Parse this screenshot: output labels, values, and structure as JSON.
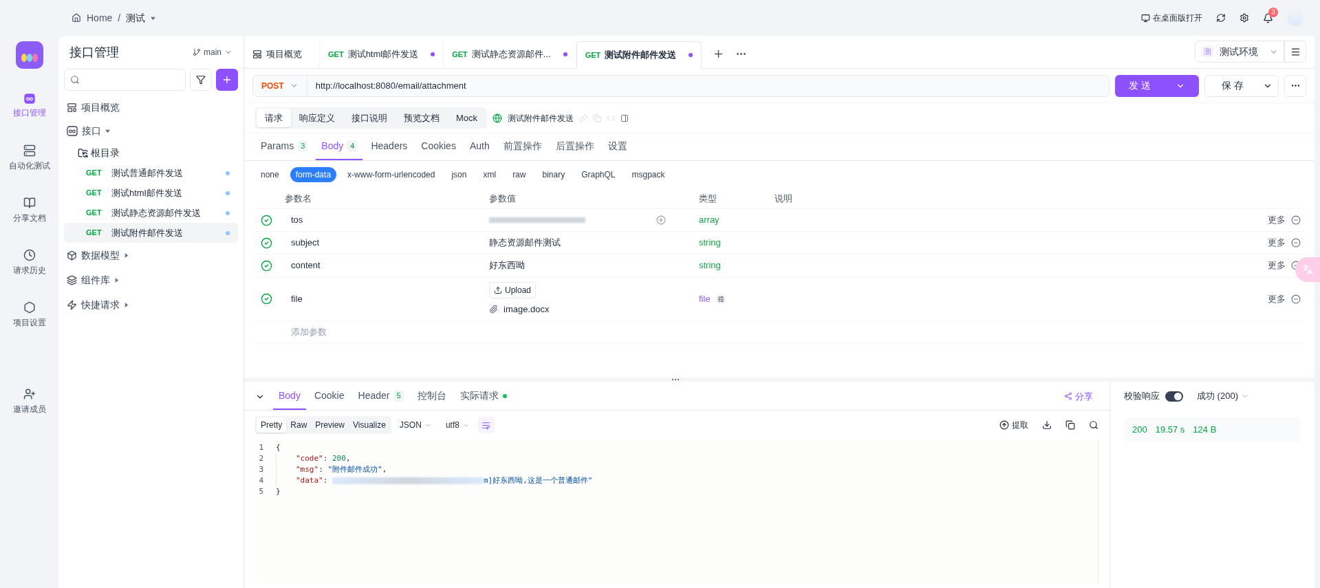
{
  "top_bar": {
    "breadcrumb": [
      "Home",
      "测试"
    ],
    "separator": "/",
    "open_desktop": "在桌面版打开",
    "notification_count": "3"
  },
  "rail": [
    {
      "label": "接口管理",
      "selected": true
    },
    {
      "label": "自动化测试",
      "selected": false
    },
    {
      "label": "分享文档",
      "selected": false
    },
    {
      "label": "请求历史",
      "selected": false
    },
    {
      "label": "项目设置",
      "selected": false
    },
    {
      "label": "邀请成员",
      "selected": false
    }
  ],
  "tree_panel": {
    "title": "接口管理",
    "branch": "main",
    "items": [
      {
        "kind": "overview",
        "label": "项目概览"
      },
      {
        "kind": "group",
        "label": "接口",
        "expanded": true,
        "children": [
          {
            "kind": "folder",
            "label": "根目录",
            "children": [
              {
                "kind": "endpoint",
                "method": "GET",
                "label": "测试普通邮件发送",
                "selected": false
              },
              {
                "kind": "endpoint",
                "method": "GET",
                "label": "测试html邮件发送",
                "selected": false
              },
              {
                "kind": "endpoint",
                "method": "GET",
                "label": "测试静态资源邮件发送",
                "selected": false
              },
              {
                "kind": "endpoint",
                "method": "GET",
                "label": "测试附件邮件发送",
                "selected": true
              }
            ]
          }
        ]
      },
      {
        "kind": "group",
        "label": "数据模型",
        "expanded": false
      },
      {
        "kind": "group",
        "label": "组件库",
        "expanded": false
      },
      {
        "kind": "group",
        "label": "快捷请求",
        "expanded": false
      }
    ]
  },
  "tabs": [
    {
      "kind": "overview",
      "label": "项目概览",
      "selected": false
    },
    {
      "kind": "endpoint",
      "method": "GET",
      "label": "测试html邮件发送",
      "selected": false,
      "unsaved": true
    },
    {
      "kind": "endpoint",
      "method": "GET",
      "label": "测试静态资源邮件...",
      "selected": false,
      "unsaved": true
    },
    {
      "kind": "endpoint",
      "method": "GET",
      "label": "测试附件邮件发送",
      "selected": true,
      "unsaved": true
    }
  ],
  "environment": {
    "badge": "测",
    "label": "测试环境"
  },
  "request": {
    "method": "POST",
    "url": "http://localhost:8080/email/attachment",
    "send": "发送",
    "save": "保存"
  },
  "request_tabs": [
    {
      "label": "请求",
      "selected": true
    },
    {
      "label": "响应定义",
      "selected": false
    },
    {
      "label": "接口说明",
      "selected": false
    },
    {
      "label": "预览文档",
      "selected": false
    },
    {
      "label": "Mock",
      "selected": false
    }
  ],
  "endpoint_name": "测试附件邮件发送",
  "param_tabs": [
    {
      "label": "Params",
      "count": "3",
      "selected": false
    },
    {
      "label": "Body",
      "count": "4",
      "selected": true
    },
    {
      "label": "Headers",
      "selected": false
    },
    {
      "label": "Cookies",
      "selected": false
    },
    {
      "label": "Auth",
      "selected": false
    },
    {
      "label": "前置操作",
      "selected": false
    },
    {
      "label": "后置操作",
      "selected": false
    },
    {
      "label": "设置",
      "selected": false
    }
  ],
  "body_types": [
    {
      "label": "none",
      "selected": false
    },
    {
      "label": "form-data",
      "selected": true
    },
    {
      "label": "x-www-form-urlencoded",
      "selected": false
    },
    {
      "label": "json",
      "selected": false
    },
    {
      "label": "xml",
      "selected": false
    },
    {
      "label": "raw",
      "selected": false
    },
    {
      "label": "binary",
      "selected": false
    },
    {
      "label": "GraphQL",
      "selected": false
    },
    {
      "label": "msgpack",
      "selected": false
    }
  ],
  "table": {
    "columns": [
      "参数名",
      "参数值",
      "类型",
      "说明"
    ],
    "rows": [
      {
        "kind": "redacted",
        "enabled": true,
        "name": "tos",
        "type": "array",
        "color": "#16a34a",
        "more": "更多"
      },
      {
        "kind": "text",
        "enabled": true,
        "name": "subject",
        "value": "静态资源邮件测试",
        "type": "string",
        "color": "#16a34a",
        "more": "更多"
      },
      {
        "kind": "text",
        "enabled": true,
        "name": "content",
        "value": "好东西呦",
        "type": "string",
        "color": "#16a34a",
        "more": "更多"
      },
      {
        "kind": "file",
        "enabled": true,
        "name": "file",
        "upload": "Upload",
        "value": "image.docx",
        "type": "file",
        "color": "#8b5cf6",
        "more": "更多"
      }
    ],
    "add_row": "添加参数"
  },
  "response": {
    "tabs": [
      {
        "label": "Body",
        "selected": true
      },
      {
        "label": "Cookie",
        "selected": false
      },
      {
        "label": "Header",
        "count": "5",
        "selected": false
      },
      {
        "label": "控制台",
        "selected": false
      },
      {
        "label": "实际请求",
        "selected": false,
        "status_dot": true
      }
    ],
    "share": "分享",
    "view_modes": [
      {
        "label": "Pretty",
        "selected": true
      },
      {
        "label": "Raw",
        "selected": false
      },
      {
        "label": "Preview",
        "selected": false
      },
      {
        "label": "Visualize",
        "selected": false
      }
    ],
    "format": "JSON",
    "encoding": "utf8",
    "extract": "提取",
    "lines": [
      {
        "number": "1",
        "tokens": [
          {
            "kind": "punct",
            "text": "{"
          }
        ]
      },
      {
        "number": "2",
        "tokens": [
          {
            "kind": "key",
            "text": "\"code\""
          },
          {
            "kind": "punct",
            "text": ": "
          },
          {
            "kind": "number",
            "text": "200"
          },
          {
            "kind": "punct",
            "text": ","
          }
        ]
      },
      {
        "number": "3",
        "tokens": [
          {
            "kind": "key",
            "text": "\"msg\""
          },
          {
            "kind": "punct",
            "text": ": "
          },
          {
            "kind": "string",
            "text": "\"附件邮件成功\""
          },
          {
            "kind": "punct",
            "text": ","
          }
        ]
      },
      {
        "number": "4",
        "tokens": [
          {
            "kind": "key",
            "text": "\"data\""
          },
          {
            "kind": "punct",
            "text": ": "
          },
          {
            "kind": "redacted"
          },
          {
            "kind": "string",
            "text": "m]好东西呦,这是一个普通邮件\""
          }
        ]
      },
      {
        "number": "5",
        "tokens": [
          {
            "kind": "punct",
            "text": "}"
          }
        ]
      }
    ]
  },
  "validation": {
    "label": "校验响应",
    "on": true,
    "status": "成功 (200)",
    "stats": [
      "200",
      "19.57 s",
      "124 B"
    ]
  }
}
